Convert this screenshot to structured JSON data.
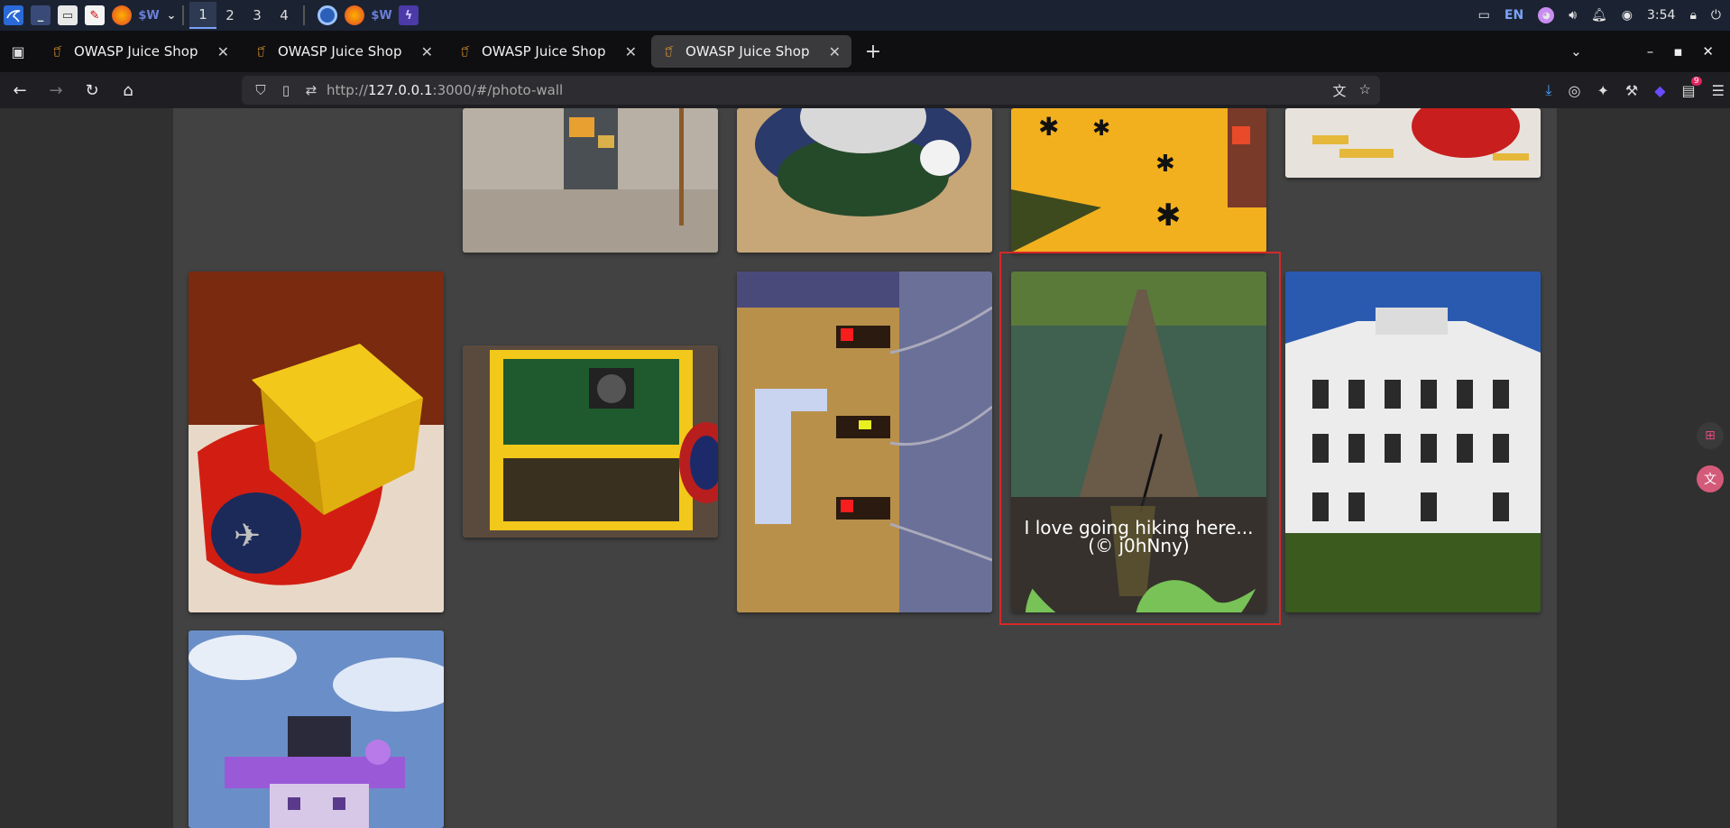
{
  "taskbar": {
    "workspaces": [
      "1",
      "2",
      "3",
      "4"
    ],
    "tray": {
      "keyboard_layout": "EN",
      "time": "3:54"
    }
  },
  "tabs": [
    {
      "title": "OWASP Juice Shop",
      "active": false
    },
    {
      "title": "OWASP Juice Shop",
      "active": false
    },
    {
      "title": "OWASP Juice Shop",
      "active": false
    },
    {
      "title": "OWASP Juice Shop",
      "active": true
    }
  ],
  "navbar": {
    "url_scheme": "http://",
    "url_host": "127.0.0.1",
    "url_rest": ":3000/#/photo-wall",
    "downloads_badge": "9"
  },
  "photo_wall": {
    "highlighted_caption": "I love going hiking here...",
    "highlighted_author": "(© j0hNny)"
  },
  "icons": {
    "back": "arrow-left-icon",
    "forward": "arrow-right-icon",
    "reload": "reload-icon",
    "home": "home-icon",
    "tweet": "twitter-icon"
  },
  "colors": {
    "highlight_border": "#d62828",
    "twitter_green": "#78c257",
    "card_bg": "#424242"
  }
}
